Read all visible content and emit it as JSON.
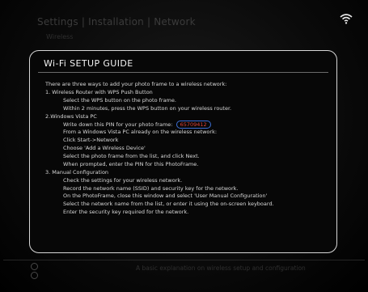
{
  "header": {
    "breadcrumb": "Settings | Installation | Network",
    "subtitle": "Wireless",
    "status_icon": "wifi-icon"
  },
  "dialog": {
    "title": "Wi-Fi SETUP GUIDE",
    "intro": "There are three ways to add your photo frame to a wireless network:",
    "section1": {
      "heading": "1. Wireless Router with WPS Push Button",
      "steps": [
        "Select the WPS button on the photo frame.",
        "Within 2 minutes, press the WPS button on your wireless router."
      ]
    },
    "section2": {
      "heading": "2.Windows Vista PC",
      "pin_prefix": "Write down this PIN for your photo frame:",
      "pin_value": "65709412",
      "pin_highlight_color": "#3b6fd6",
      "pin_text_color": "#e0443a",
      "steps": [
        "From a Windows Vista PC already on the wireless network:",
        "Click Start->Network",
        "Choose 'Add a Wireless Device'",
        "Select the photo frame from the list, and click Next.",
        "When prompted, enter the PIN for this PhotoFrame."
      ]
    },
    "section3": {
      "heading": "3. Manual Configuration",
      "steps": [
        "Check the settings for your wireless network.",
        "Record the network name (SSID) and security key for the network.",
        "On the PhotoFrame, close this window and select 'User Manual Configuration'",
        "Select the network name from the list, or enter it using the on-screen keyboard.",
        "Enter the security key required for the network."
      ]
    }
  },
  "footer": {
    "hint": "A basic explanation on wireless setup and configuration",
    "icons": [
      "ok-icon",
      "menu-icon"
    ]
  }
}
